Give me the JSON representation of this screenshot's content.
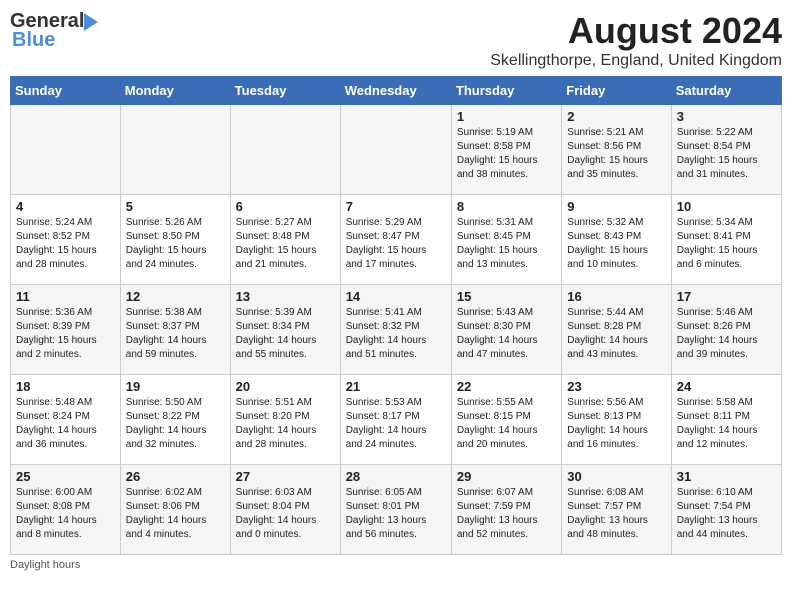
{
  "header": {
    "logo_general": "General",
    "logo_blue": "Blue",
    "month_year": "August 2024",
    "location": "Skellingthorpe, England, United Kingdom"
  },
  "days_of_week": [
    "Sunday",
    "Monday",
    "Tuesday",
    "Wednesday",
    "Thursday",
    "Friday",
    "Saturday"
  ],
  "weeks": [
    [
      {
        "day": "",
        "info": ""
      },
      {
        "day": "",
        "info": ""
      },
      {
        "day": "",
        "info": ""
      },
      {
        "day": "",
        "info": ""
      },
      {
        "day": "1",
        "info": "Sunrise: 5:19 AM\nSunset: 8:58 PM\nDaylight: 15 hours\nand 38 minutes."
      },
      {
        "day": "2",
        "info": "Sunrise: 5:21 AM\nSunset: 8:56 PM\nDaylight: 15 hours\nand 35 minutes."
      },
      {
        "day": "3",
        "info": "Sunrise: 5:22 AM\nSunset: 8:54 PM\nDaylight: 15 hours\nand 31 minutes."
      }
    ],
    [
      {
        "day": "4",
        "info": "Sunrise: 5:24 AM\nSunset: 8:52 PM\nDaylight: 15 hours\nand 28 minutes."
      },
      {
        "day": "5",
        "info": "Sunrise: 5:26 AM\nSunset: 8:50 PM\nDaylight: 15 hours\nand 24 minutes."
      },
      {
        "day": "6",
        "info": "Sunrise: 5:27 AM\nSunset: 8:48 PM\nDaylight: 15 hours\nand 21 minutes."
      },
      {
        "day": "7",
        "info": "Sunrise: 5:29 AM\nSunset: 8:47 PM\nDaylight: 15 hours\nand 17 minutes."
      },
      {
        "day": "8",
        "info": "Sunrise: 5:31 AM\nSunset: 8:45 PM\nDaylight: 15 hours\nand 13 minutes."
      },
      {
        "day": "9",
        "info": "Sunrise: 5:32 AM\nSunset: 8:43 PM\nDaylight: 15 hours\nand 10 minutes."
      },
      {
        "day": "10",
        "info": "Sunrise: 5:34 AM\nSunset: 8:41 PM\nDaylight: 15 hours\nand 6 minutes."
      }
    ],
    [
      {
        "day": "11",
        "info": "Sunrise: 5:36 AM\nSunset: 8:39 PM\nDaylight: 15 hours\nand 2 minutes."
      },
      {
        "day": "12",
        "info": "Sunrise: 5:38 AM\nSunset: 8:37 PM\nDaylight: 14 hours\nand 59 minutes."
      },
      {
        "day": "13",
        "info": "Sunrise: 5:39 AM\nSunset: 8:34 PM\nDaylight: 14 hours\nand 55 minutes."
      },
      {
        "day": "14",
        "info": "Sunrise: 5:41 AM\nSunset: 8:32 PM\nDaylight: 14 hours\nand 51 minutes."
      },
      {
        "day": "15",
        "info": "Sunrise: 5:43 AM\nSunset: 8:30 PM\nDaylight: 14 hours\nand 47 minutes."
      },
      {
        "day": "16",
        "info": "Sunrise: 5:44 AM\nSunset: 8:28 PM\nDaylight: 14 hours\nand 43 minutes."
      },
      {
        "day": "17",
        "info": "Sunrise: 5:46 AM\nSunset: 8:26 PM\nDaylight: 14 hours\nand 39 minutes."
      }
    ],
    [
      {
        "day": "18",
        "info": "Sunrise: 5:48 AM\nSunset: 8:24 PM\nDaylight: 14 hours\nand 36 minutes."
      },
      {
        "day": "19",
        "info": "Sunrise: 5:50 AM\nSunset: 8:22 PM\nDaylight: 14 hours\nand 32 minutes."
      },
      {
        "day": "20",
        "info": "Sunrise: 5:51 AM\nSunset: 8:20 PM\nDaylight: 14 hours\nand 28 minutes."
      },
      {
        "day": "21",
        "info": "Sunrise: 5:53 AM\nSunset: 8:17 PM\nDaylight: 14 hours\nand 24 minutes."
      },
      {
        "day": "22",
        "info": "Sunrise: 5:55 AM\nSunset: 8:15 PM\nDaylight: 14 hours\nand 20 minutes."
      },
      {
        "day": "23",
        "info": "Sunrise: 5:56 AM\nSunset: 8:13 PM\nDaylight: 14 hours\nand 16 minutes."
      },
      {
        "day": "24",
        "info": "Sunrise: 5:58 AM\nSunset: 8:11 PM\nDaylight: 14 hours\nand 12 minutes."
      }
    ],
    [
      {
        "day": "25",
        "info": "Sunrise: 6:00 AM\nSunset: 8:08 PM\nDaylight: 14 hours\nand 8 minutes."
      },
      {
        "day": "26",
        "info": "Sunrise: 6:02 AM\nSunset: 8:06 PM\nDaylight: 14 hours\nand 4 minutes."
      },
      {
        "day": "27",
        "info": "Sunrise: 6:03 AM\nSunset: 8:04 PM\nDaylight: 14 hours\nand 0 minutes."
      },
      {
        "day": "28",
        "info": "Sunrise: 6:05 AM\nSunset: 8:01 PM\nDaylight: 13 hours\nand 56 minutes."
      },
      {
        "day": "29",
        "info": "Sunrise: 6:07 AM\nSunset: 7:59 PM\nDaylight: 13 hours\nand 52 minutes."
      },
      {
        "day": "30",
        "info": "Sunrise: 6:08 AM\nSunset: 7:57 PM\nDaylight: 13 hours\nand 48 minutes."
      },
      {
        "day": "31",
        "info": "Sunrise: 6:10 AM\nSunset: 7:54 PM\nDaylight: 13 hours\nand 44 minutes."
      }
    ]
  ],
  "footer": {
    "daylight_hours": "Daylight hours"
  }
}
